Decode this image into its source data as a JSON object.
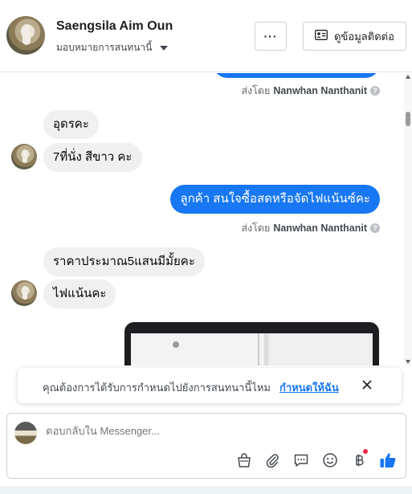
{
  "header": {
    "contact_name": "Saengsila Aim Oun",
    "assign_label": "มอบหมายการสนทนานี้",
    "more_label": "···",
    "info_button_label": "ดูข้อมูลติดต่อ"
  },
  "messages": {
    "sentby_prefix": "ส่งโดย",
    "sentby_name": "Nanwhan Nanthanit",
    "items": [
      {
        "text": "อุดรคะ"
      },
      {
        "text": "7ที่นั่ง สีขาว คะ"
      },
      {
        "text": "ลูกค้า สนใจซื้อสดหรือจัดไฟแน้นซ์คะ"
      },
      {
        "text": "ราคาประมาณ5แสนมีมั้ยคะ"
      },
      {
        "text": "ไฟแน้นคะ"
      }
    ]
  },
  "banner": {
    "text": "คุณต้องการได้รับการกำหนดไปยังการสนทนานี้ไหม",
    "link": "กำหนดให้ฉัน"
  },
  "composer": {
    "placeholder": "ตอบกลับใน Messenger..."
  },
  "colors": {
    "accent": "#1877f2",
    "incoming_bubble": "#f0f0f0",
    "notification_dot": "#f02849"
  },
  "icons": [
    "ellipsis-icon",
    "contact-card-icon",
    "caret-down-icon",
    "help-icon",
    "close-icon",
    "bag-icon",
    "attachment-icon",
    "saved-reply-icon",
    "emoji-icon",
    "baht-icon",
    "thumbs-up-icon"
  ]
}
